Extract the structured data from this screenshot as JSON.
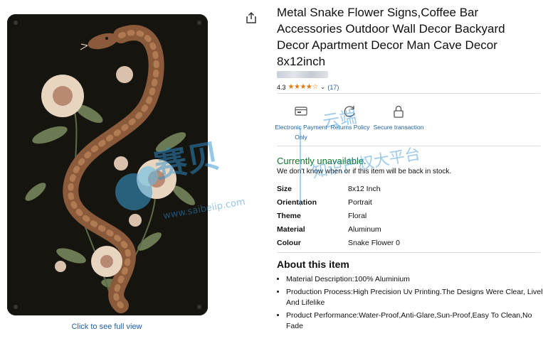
{
  "image": {
    "alt": "Metal snake flower sign image",
    "view_link": "Click to see full view"
  },
  "share": {
    "icon": "share-icon"
  },
  "product": {
    "title": "Metal Snake Flower Signs,Coffee Bar Accessories Outdoor Wall Decor Backyard Decor Apartment Decor Man Cave Decor 8x12inch",
    "rating": "4.3",
    "stars": "★★★★☆",
    "rating_count": "(17)"
  },
  "features": [
    {
      "icon": "card-payment-icon",
      "label": "Electronic Payment Only"
    },
    {
      "icon": "returns-icon",
      "label": "Returns Policy"
    },
    {
      "icon": "lock-icon",
      "label": "Secure transaction"
    }
  ],
  "availability": {
    "status": "Currently unavailable.",
    "note": "We don't know when or if this item will be back in stock."
  },
  "specs": [
    {
      "key": "Size",
      "value": "8x12 Inch"
    },
    {
      "key": "Orientation",
      "value": "Portrait"
    },
    {
      "key": "Theme",
      "value": "Floral"
    },
    {
      "key": "Material",
      "value": "Aluminum"
    },
    {
      "key": "Colour",
      "value": "Snake Flower 0"
    }
  ],
  "about": {
    "heading": "About this item",
    "bullets": [
      "Material Description:100% Aluminium",
      "Production Process:High Precision Uv Printing.The Designs Were Clear, Lively And Lifelike",
      "Product Performance:Water-Proof,Anti-Glare,Sun-Proof,Easy To Clean,No Fade"
    ]
  },
  "watermark": {
    "text_1": "赛贝",
    "text_2": "www.saibeiip.com",
    "text_3": "知识产权大平台",
    "text_4": "云端"
  },
  "colors": {
    "link": "#2162a1",
    "available_green": "#0a7a2b",
    "star": "#e47911",
    "sign_bg": "#16140f"
  }
}
